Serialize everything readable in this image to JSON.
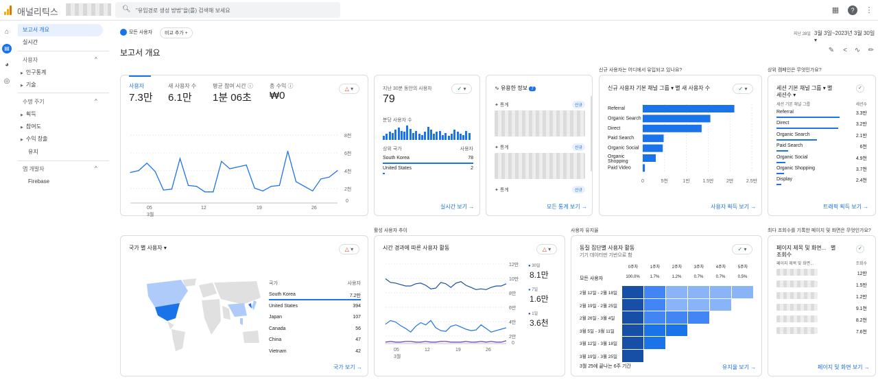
{
  "topbar": {
    "app_title": "애널리틱스",
    "search_placeholder": "\"유입경로 생성 방법\"을(를) 검색해 보세요"
  },
  "icons": {
    "search": "search-icon",
    "apps": "apps-grid-icon",
    "help": "help-icon",
    "home": "home-icon",
    "reports": "reports-icon",
    "explore": "explore-icon",
    "advertising": "advertising-icon"
  },
  "sidebar": {
    "overview": "보고서 개요",
    "realtime": "실시간",
    "user_section": "사용자",
    "demographics": "인구통계",
    "tech": "기술",
    "lifecycle_section": "수명 주기",
    "acquisition": "획득",
    "engagement": "참여도",
    "monetization": "수익 창출",
    "retention": "유지",
    "dev_section": "앱 개발자",
    "firebase": "Firebase"
  },
  "toolbar": {
    "all_users": "모든 사용자",
    "add_compare": "비교 추가",
    "date_label": "지난 28일",
    "date_range": "3월 3일~2023년 3월 30일"
  },
  "page": {
    "title": "보고서 개요"
  },
  "colors": {
    "primary": "#1a73e8",
    "dark_blue": "#174ea6",
    "warn": "#d93025",
    "ok": "#188038",
    "purple": "#5e35b1"
  },
  "kpi": {
    "users_label": "사용자",
    "users_value": "7.3만",
    "new_users_label": "새 사용자 수",
    "new_users_value": "6.1만",
    "engage_label": "평균 참여 시간",
    "engage_value": "1분 06초",
    "revenue_label": "총 수익",
    "revenue_value": "₩0",
    "y_ticks": [
      "8천",
      "6천",
      "4천",
      "2천",
      "0"
    ],
    "x_ticks": [
      "05\n3월",
      "12",
      "19",
      "26"
    ],
    "x_tick_05": "05",
    "x_tick_month": "3월"
  },
  "realtime": {
    "header": "지난 30분 동안의 사용자",
    "value": "79",
    "per_minute": "분당 사용자 수",
    "col_country": "상위 국가",
    "col_users": "사용자",
    "rows": [
      {
        "name": "South Korea",
        "value": "78"
      },
      {
        "name": "United States",
        "value": "2"
      }
    ],
    "link": "실시간 보기"
  },
  "insights": {
    "title": "유용한 정보",
    "badge": "7",
    "item_label": "통계",
    "new_badge": "신규",
    "link": "모든 통계 보기"
  },
  "acq_section": {
    "question": "신규 사용자는 어디에서 유입되고 있나요?",
    "card_title": "신규 사용자 기본 채널 그룹 ▾ 별 새 사용자 수",
    "link": "사용자 획득 보기"
  },
  "chart_data": [
    {
      "type": "line",
      "title": "",
      "series": [
        {
          "name": "사용자",
          "values": [
            3.3,
            3.5,
            4.3,
            3.4,
            1.4,
            1.5,
            4.8,
            1.9,
            1.8,
            1.2,
            1.2,
            4.5,
            3.7,
            3.9,
            4.1,
            1.6,
            1.3,
            1.8,
            1.9,
            5.6,
            2.3,
            1.8,
            1.3,
            2.6,
            2.8,
            3.5
          ]
        }
      ],
      "ylim": [
        0,
        8
      ]
    },
    {
      "type": "bar",
      "title": "",
      "categories": [
        "Referral",
        "Organic Search",
        "Direct",
        "Paid Search",
        "Organic Social",
        "Organic Shopping",
        "Paid Video"
      ],
      "values": [
        21000,
        15500,
        13500,
        4800,
        4600,
        3000,
        500
      ],
      "xlim": [
        0,
        25000
      ],
      "x_ticks": [
        "0",
        "5천",
        "1만",
        "1.5만",
        "2만",
        "2.5만"
      ]
    },
    {
      "type": "line",
      "title": "",
      "series": [
        {
          "name": "30일",
          "values": [
            9.0,
            8.5,
            8.4,
            8.2,
            8.0,
            8.0,
            8.3,
            8.4,
            8.1,
            7.6,
            7.7,
            8.5,
            8.3,
            7.8,
            8.4,
            8.6,
            8.1,
            7.8,
            7.5,
            7.6,
            7.5,
            7.8,
            8.0,
            8.0,
            8.3
          ]
        },
        {
          "name": "7일",
          "values": [
            2.7,
            3.2,
            3.0,
            2.5,
            2.1,
            1.6,
            2.4,
            2.9,
            2.6,
            3.2,
            2.2,
            1.8,
            1.7,
            2.4,
            2.6,
            2.3,
            2.0,
            1.8,
            1.9,
            2.6,
            2.1,
            1.6,
            1.8,
            2.0,
            2.2
          ]
        },
        {
          "name": "1일",
          "values": [
            0.2,
            0.3,
            0.2,
            0.2,
            0.3,
            0.3,
            0.2,
            0.2,
            0.3,
            0.2,
            0.2,
            0.3,
            0.3,
            0.2,
            0.2,
            0.2,
            0.3,
            0.2,
            0.2,
            0.3,
            0.2,
            0.3,
            0.2,
            0.2,
            0.4
          ]
        }
      ],
      "ylim": [
        0,
        12
      ]
    }
  ],
  "session_section": {
    "question": "상위 캠페인은 무엇인가요?",
    "title1": "세션 기본 채널 그룹 ▾ 별",
    "title2": "세션수 ▾",
    "col1": "세션 기본 채널 그룹",
    "col2": "세션수",
    "rows": [
      {
        "name": "Referral",
        "value": "3.3만",
        "frac": 0.7
      },
      {
        "name": "Direct",
        "value": "3.2만",
        "frac": 0.68
      },
      {
        "name": "Organic Search",
        "value": "2.1만",
        "frac": 0.45
      },
      {
        "name": "Paid Search",
        "value": "6천",
        "frac": 0.13
      },
      {
        "name": "Organic Social",
        "value": "4.9천",
        "frac": 0.1
      },
      {
        "name": "Organic Shopping",
        "value": "3.7천",
        "frac": 0.08
      },
      {
        "name": "Display",
        "value": "2.4천",
        "frac": 0.05
      }
    ],
    "link": "트래픽 획득 보기"
  },
  "country": {
    "title": "국가 별 사용자 ▾",
    "col1": "국가",
    "col2": "사용자",
    "rows": [
      {
        "name": "South Korea",
        "value": "7.2만"
      },
      {
        "name": "United States",
        "value": "394"
      },
      {
        "name": "Japan",
        "value": "107"
      },
      {
        "name": "Canada",
        "value": "56"
      },
      {
        "name": "China",
        "value": "47"
      },
      {
        "name": "Vietnam",
        "value": "42"
      }
    ],
    "link": "국가 보기"
  },
  "active": {
    "section": "활성 사용자 추이",
    "title": "시간 경과에 따른 사용자 활동",
    "y_ticks": [
      "12만",
      "10만",
      "8만",
      "6만",
      "4만",
      "2만",
      "0"
    ],
    "legend": [
      {
        "name": "30일",
        "value": "8.1만"
      },
      {
        "name": "7일",
        "value": "1.6만"
      },
      {
        "name": "1일",
        "value": "3.6천"
      }
    ]
  },
  "cohort": {
    "section": "사용자 유지율",
    "title": "동질 집단별 사용자 활동",
    "subtitle": "기기 데이터만 기반으로 함",
    "weeks": [
      "0주차",
      "1주차",
      "2주차",
      "3주차",
      "4주차",
      "5주차"
    ],
    "all_label": "모든 사용자",
    "all_values": [
      "100.0%",
      "1.7%",
      "1.2%",
      "0.7%",
      "0.7%",
      "0.5%"
    ],
    "rows": [
      "2월 12일 - 2월 18일",
      "2월 19일 - 2월 25일",
      "2월 26일 - 3월 4일",
      "3월 5일 - 3월 11일",
      "3월 12일 - 3월 18일",
      "3월 19일 - 3월 25일"
    ],
    "footer": "3월 25에 끝나는 6주 기간",
    "link": "유지율 보기"
  },
  "pages": {
    "section": "최다 조회수를 기록한 페이지 및 화면은 무엇인가요?",
    "title1": "페이지 제목 및 화면...",
    "title1b": "별",
    "title2": "조회수",
    "col1": "페이지 제목 및 화면...",
    "col2": "조회수",
    "values": [
      "12만",
      "1.5만",
      "1.2만",
      "9.1천",
      "8.2천",
      "7.6천"
    ],
    "link": "페이지 및 화면 보기"
  }
}
